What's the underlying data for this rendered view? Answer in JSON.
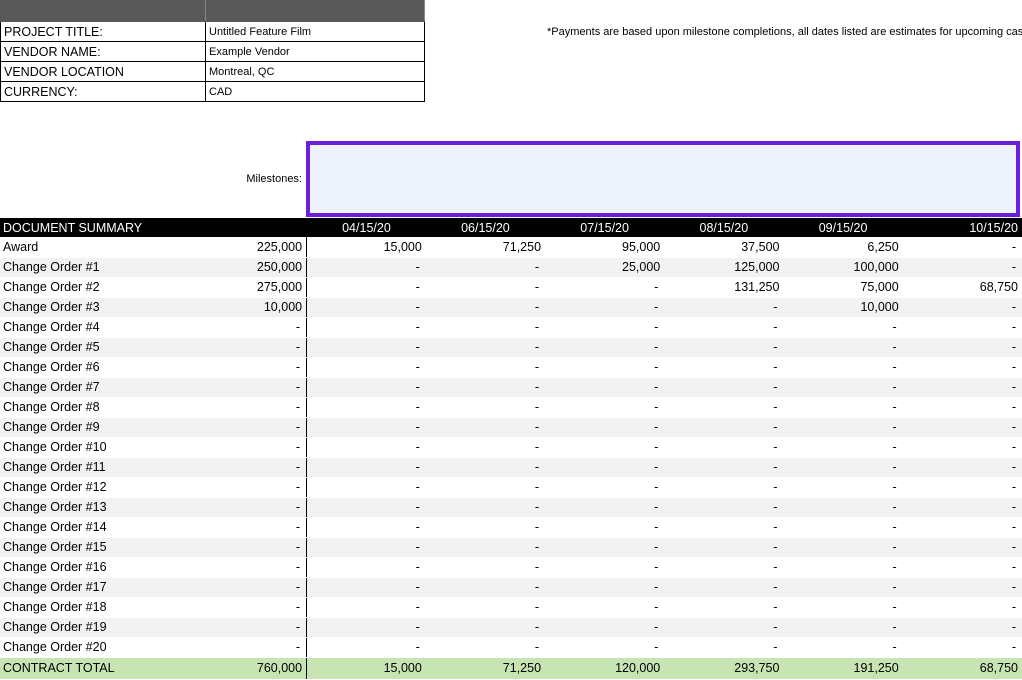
{
  "info": {
    "rows": [
      {
        "label": "PROJECT TITLE:",
        "value": "Untitled Feature Film"
      },
      {
        "label": "VENDOR NAME:",
        "value": "Example Vendor"
      },
      {
        "label": "VENDOR LOCATION",
        "value": "Montreal, QC"
      },
      {
        "label": "CURRENCY:",
        "value": "CAD"
      }
    ]
  },
  "note": "*Payments are based upon milestone completions, all dates listed are estimates for upcoming cas",
  "milestones_label": "Milestones:",
  "summary": {
    "title": "DOCUMENT SUMMARY",
    "dates": [
      "04/15/20",
      "06/15/20",
      "07/15/20",
      "08/15/20",
      "09/15/20",
      "10/15/20"
    ],
    "rows": [
      {
        "name": "Award",
        "total": "225,000",
        "values": [
          "15,000",
          "71,250",
          "95,000",
          "37,500",
          "6,250",
          "-"
        ]
      },
      {
        "name": "Change Order #1",
        "total": "250,000",
        "values": [
          "-",
          "-",
          "25,000",
          "125,000",
          "100,000",
          "-"
        ]
      },
      {
        "name": "Change Order #2",
        "total": "275,000",
        "values": [
          "-",
          "-",
          "-",
          "131,250",
          "75,000",
          "68,750"
        ]
      },
      {
        "name": "Change Order #3",
        "total": "10,000",
        "values": [
          "-",
          "-",
          "-",
          "-",
          "10,000",
          "-"
        ]
      },
      {
        "name": "Change Order #4",
        "total": "-",
        "values": [
          "-",
          "-",
          "-",
          "-",
          "-",
          "-"
        ]
      },
      {
        "name": "Change Order #5",
        "total": "-",
        "values": [
          "-",
          "-",
          "-",
          "-",
          "-",
          "-"
        ]
      },
      {
        "name": "Change Order #6",
        "total": "-",
        "values": [
          "-",
          "-",
          "-",
          "-",
          "-",
          "-"
        ]
      },
      {
        "name": "Change Order #7",
        "total": "-",
        "values": [
          "-",
          "-",
          "-",
          "-",
          "-",
          "-"
        ]
      },
      {
        "name": "Change Order #8",
        "total": "-",
        "values": [
          "-",
          "-",
          "-",
          "-",
          "-",
          "-"
        ]
      },
      {
        "name": "Change Order #9",
        "total": "-",
        "values": [
          "-",
          "-",
          "-",
          "-",
          "-",
          "-"
        ]
      },
      {
        "name": "Change Order #10",
        "total": "-",
        "values": [
          "-",
          "-",
          "-",
          "-",
          "-",
          "-"
        ]
      },
      {
        "name": "Change Order #11",
        "total": "-",
        "values": [
          "-",
          "-",
          "-",
          "-",
          "-",
          "-"
        ]
      },
      {
        "name": "Change Order #12",
        "total": "-",
        "values": [
          "-",
          "-",
          "-",
          "-",
          "-",
          "-"
        ]
      },
      {
        "name": "Change Order #13",
        "total": "-",
        "values": [
          "-",
          "-",
          "-",
          "-",
          "-",
          "-"
        ]
      },
      {
        "name": "Change Order #14",
        "total": "-",
        "values": [
          "-",
          "-",
          "-",
          "-",
          "-",
          "-"
        ]
      },
      {
        "name": "Change Order #15",
        "total": "-",
        "values": [
          "-",
          "-",
          "-",
          "-",
          "-",
          "-"
        ]
      },
      {
        "name": "Change Order #16",
        "total": "-",
        "values": [
          "-",
          "-",
          "-",
          "-",
          "-",
          "-"
        ]
      },
      {
        "name": "Change Order #17",
        "total": "-",
        "values": [
          "-",
          "-",
          "-",
          "-",
          "-",
          "-"
        ]
      },
      {
        "name": "Change Order #18",
        "total": "-",
        "values": [
          "-",
          "-",
          "-",
          "-",
          "-",
          "-"
        ]
      },
      {
        "name": "Change Order #19",
        "total": "-",
        "values": [
          "-",
          "-",
          "-",
          "-",
          "-",
          "-"
        ]
      },
      {
        "name": "Change Order #20",
        "total": "-",
        "values": [
          "-",
          "-",
          "-",
          "-",
          "-",
          "-"
        ]
      }
    ],
    "footer": {
      "name": "CONTRACT TOTAL",
      "total": "760,000",
      "values": [
        "15,000",
        "71,250",
        "120,000",
        "293,750",
        "191,250",
        "68,750"
      ]
    }
  },
  "colors": {
    "header_bg": "#000000",
    "footer_bg": "#c6e5b3",
    "milestone_border": "#6a1fdb",
    "milestone_fill": "#edf3fd"
  }
}
